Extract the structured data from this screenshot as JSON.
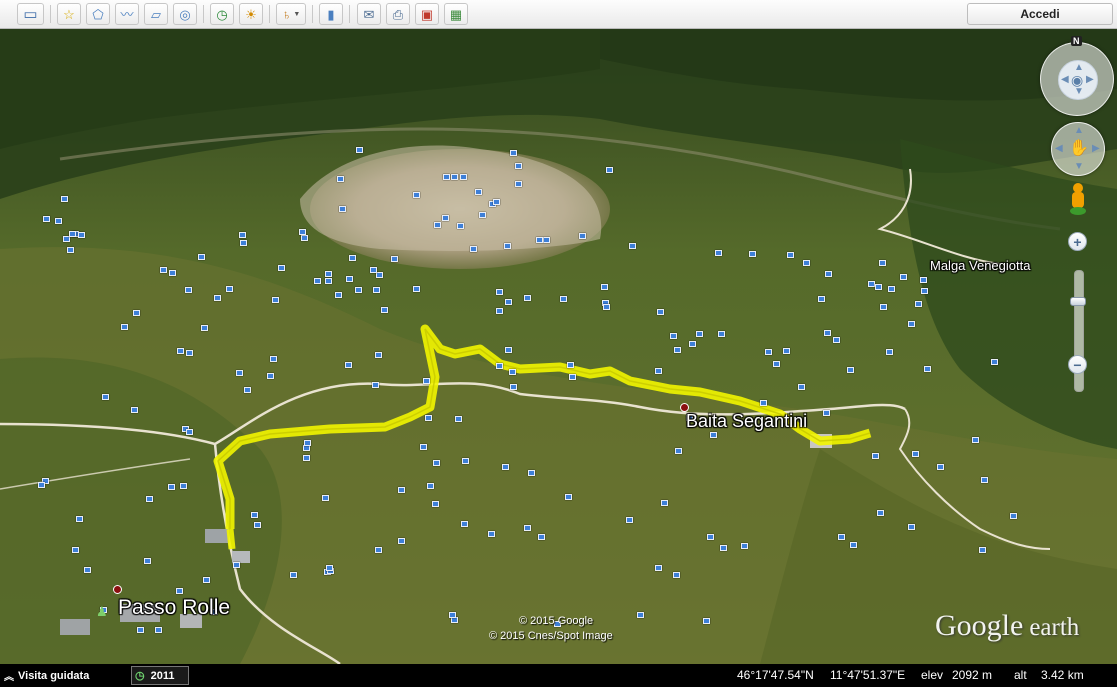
{
  "toolbar": {
    "buttons": [
      {
        "name": "sidebar-toggle-button",
        "icon": "sidebar-icon",
        "glyph": "▭"
      },
      {
        "name": "add-placemark-button",
        "icon": "placemark-icon",
        "glyph": "☆"
      },
      {
        "name": "add-polygon-button",
        "icon": "polygon-icon",
        "glyph": "⬠"
      },
      {
        "name": "add-path-button",
        "icon": "path-icon",
        "glyph": "〰"
      },
      {
        "name": "add-overlay-button",
        "icon": "overlay-icon",
        "glyph": "▱"
      },
      {
        "name": "record-tour-button",
        "icon": "camera-icon",
        "glyph": "◎"
      },
      {
        "name": "historical-imagery-button",
        "icon": "clock-icon",
        "glyph": "◷"
      },
      {
        "name": "sunlight-button",
        "icon": "sun-icon",
        "glyph": "☀"
      },
      {
        "name": "switch-planet-button",
        "icon": "planet-icon",
        "glyph": "♄"
      },
      {
        "name": "ruler-button",
        "icon": "ruler-icon",
        "glyph": "▮"
      },
      {
        "name": "email-button",
        "icon": "envelope-icon",
        "glyph": "✉"
      },
      {
        "name": "print-button",
        "icon": "printer-icon",
        "glyph": "⎙"
      },
      {
        "name": "show-in-maps-button",
        "icon": "maps-icon",
        "glyph": "▣"
      },
      {
        "name": "save-image-button",
        "icon": "image-icon",
        "glyph": "▦"
      }
    ],
    "signin_label": "Accedi"
  },
  "map": {
    "labels": {
      "malga": "Malga Venegiotta",
      "baita": "Baita Segantini",
      "passo": "Passo Rolle"
    },
    "copyright": [
      "© 2015 Google",
      "© 2015 Cnes/Spot Image"
    ],
    "logo": {
      "google": "Google",
      "earth": "earth"
    },
    "compass_north": "N",
    "zoom_in": "+",
    "zoom_out": "−",
    "path_color": "#f2f500",
    "terrain_colors": {
      "forest": "#2f4a1e",
      "meadow": "#5a6a2c",
      "rock": "#c8b9a3"
    }
  },
  "status": {
    "tour_label": "Visita guidata",
    "imagery_year": "2011",
    "latitude": "46°17'47.54\"N",
    "longitude": "11°47'51.37\"E",
    "elev_label": "elev",
    "elev_value": "2092 m",
    "alt_label": "alt",
    "alt_value": "3.42 km"
  }
}
